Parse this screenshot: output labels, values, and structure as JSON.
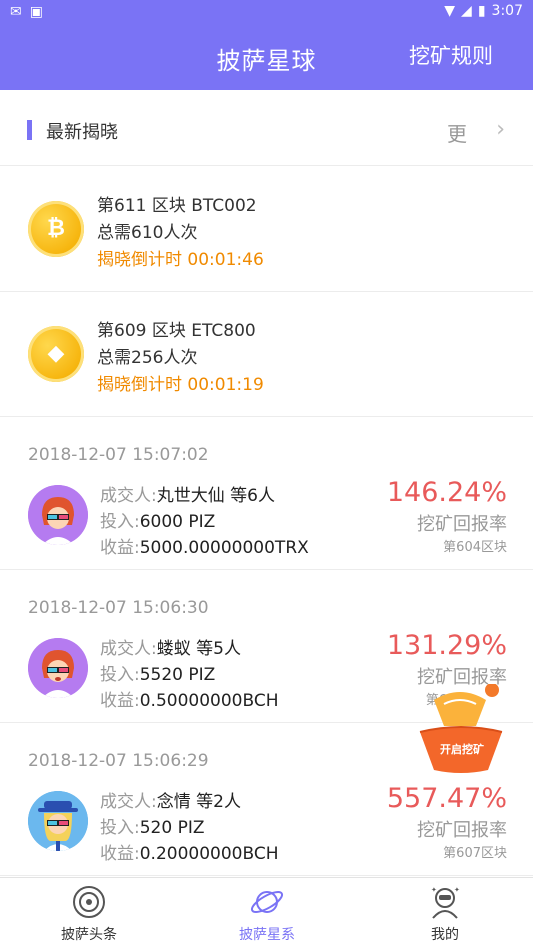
{
  "status": {
    "time": "3:07"
  },
  "appbar": {
    "title": "披萨星球",
    "rule": "挖矿规则"
  },
  "section": {
    "label": "最新揭晓",
    "more": "更",
    "chevron": "›"
  },
  "announcements": [
    {
      "line1": "第611 区块  BTC002",
      "line2": "总需610人次",
      "line3": "揭晓倒计时 00:01:46",
      "coin_symbol": "₿"
    },
    {
      "line1": "第609 区块  ETC800",
      "line2": "总需256人次",
      "line3": "揭晓倒计时 00:01:19",
      "coin_symbol": "◆"
    }
  ],
  "records": [
    {
      "date": "2018-12-07 15:07:02",
      "buyer_key": "成交人:",
      "buyer": "丸世大仙 等6人",
      "invest_key": "投入:",
      "invest": "6000 PIZ",
      "income_key": "收益:",
      "income": "5000.00000000TRX",
      "rate": "146.24%",
      "rate_label": "挖矿回报率",
      "block": "第604区块"
    },
    {
      "date": "2018-12-07 15:06:30",
      "buyer_key": "成交人:",
      "buyer": "蝼蚁 等5人",
      "invest_key": "投入:",
      "invest": "5520 PIZ",
      "income_key": "收益:",
      "income": "0.50000000BCH",
      "rate": "131.29%",
      "rate_label": "挖矿回报率",
      "block": "第6"
    },
    {
      "date": "2018-12-07 15:06:29",
      "buyer_key": "成交人:",
      "buyer": "念情 等2人",
      "invest_key": "投入:",
      "invest": "520 PIZ",
      "income_key": "收益:",
      "income": "0.20000000BCH",
      "rate": "557.47%",
      "rate_label": "挖矿回报率",
      "block": "第607区块"
    }
  ],
  "float_button": {
    "label": "开启挖矿"
  },
  "tabs": [
    {
      "label": "披萨头条",
      "icon": "news-icon"
    },
    {
      "label": "披萨星系",
      "icon": "planet-icon"
    },
    {
      "label": "我的",
      "icon": "profile-icon"
    }
  ],
  "colors": {
    "accent": "#7a73f5",
    "rate": "#e85a5a",
    "countdown": "#f08a00"
  }
}
